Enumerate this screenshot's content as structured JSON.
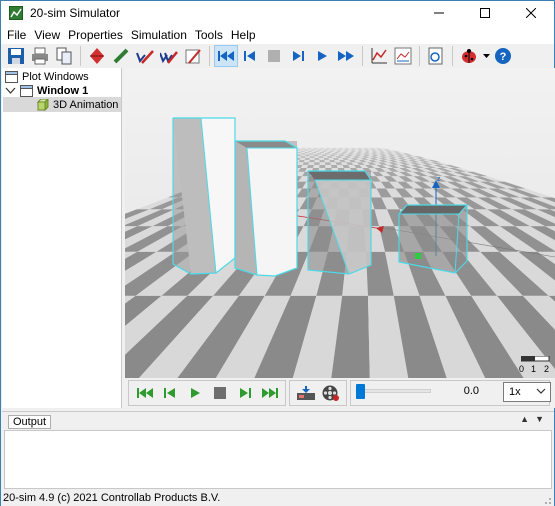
{
  "window": {
    "title": "20-sim Simulator"
  },
  "menu": [
    "File",
    "View",
    "Properties",
    "Simulation",
    "Tools",
    "Help"
  ],
  "tree": {
    "root": "Plot Windows",
    "window": "Window 1",
    "child": "3D Animation"
  },
  "viewport": {
    "axis_label": "z",
    "scale_labels": [
      "0",
      "1",
      "2"
    ]
  },
  "playback": {
    "time": "0.0",
    "speed": "1x",
    "position_fraction": 0.0
  },
  "output": {
    "tab": "Output"
  },
  "status": {
    "text": "20-sim 4.9 (c) 2021 Controllab Products B.V."
  },
  "colors": {
    "accent": "#0078d7",
    "edge": "#4dd9e8",
    "floor_dark": "#8a8a8a",
    "floor_light": "#d8d8d8"
  }
}
